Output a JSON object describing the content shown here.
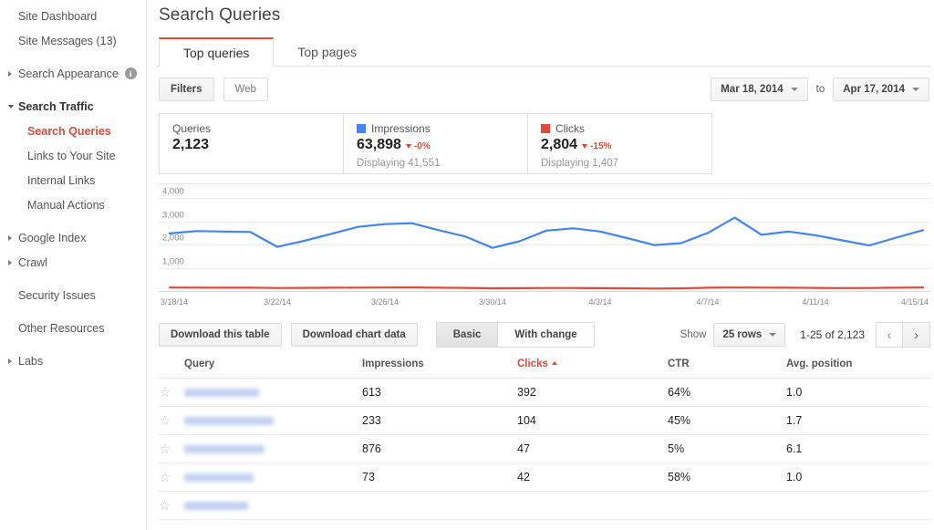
{
  "sidebar": {
    "items": [
      {
        "label": "Site Dashboard",
        "level": 0,
        "arrow": "none",
        "state": "normal",
        "info": false
      },
      {
        "label": "Site Messages (13)",
        "level": 0,
        "arrow": "none",
        "state": "normal",
        "info": false
      },
      {
        "label": "Search Appearance",
        "level": 0,
        "arrow": "right",
        "state": "normal",
        "info": true
      },
      {
        "label": "Search Traffic",
        "level": 0,
        "arrow": "down",
        "state": "bold",
        "info": false
      },
      {
        "label": "Search Queries",
        "level": 1,
        "arrow": "none",
        "state": "active",
        "info": false
      },
      {
        "label": "Links to Your Site",
        "level": 1,
        "arrow": "none",
        "state": "normal",
        "info": false
      },
      {
        "label": "Internal Links",
        "level": 1,
        "arrow": "none",
        "state": "normal",
        "info": false
      },
      {
        "label": "Manual Actions",
        "level": 1,
        "arrow": "none",
        "state": "normal",
        "info": false
      },
      {
        "label": "Google Index",
        "level": 0,
        "arrow": "right",
        "state": "normal",
        "info": false
      },
      {
        "label": "Crawl",
        "level": 0,
        "arrow": "right",
        "state": "normal",
        "info": false
      },
      {
        "label": "Security Issues",
        "level": 0,
        "arrow": "none",
        "state": "normal",
        "info": false
      },
      {
        "label": "Other Resources",
        "level": 0,
        "arrow": "none",
        "state": "normal",
        "info": false
      },
      {
        "label": "Labs",
        "level": 0,
        "arrow": "right",
        "state": "normal",
        "info": false
      }
    ],
    "info_glyph": "i"
  },
  "header": {
    "title": "Search Queries"
  },
  "tabs": [
    {
      "label": "Top queries",
      "active": true
    },
    {
      "label": "Top pages",
      "active": false
    }
  ],
  "toolbar": {
    "filters_label": "Filters",
    "web_label": "Web",
    "date_from": "Mar 18, 2014",
    "date_to_word": "to",
    "date_to": "Apr 17, 2014"
  },
  "summary": {
    "queries": {
      "label": "Queries",
      "value": "2,123"
    },
    "impressions": {
      "label": "Impressions",
      "value": "63,898",
      "delta": "-0%",
      "delta_direction": "down",
      "sub": "Displaying 41,551",
      "color": "#4285f4"
    },
    "clicks": {
      "label": "Clicks",
      "value": "2,804",
      "delta": "-15%",
      "delta_direction": "down",
      "sub": "Displaying 1,407",
      "color": "#dd4b39"
    }
  },
  "table_controls": {
    "download_table": "Download this table",
    "download_chart": "Download chart data",
    "basic": "Basic",
    "with_change": "With change",
    "show_label": "Show",
    "rows_value": "25 rows",
    "range_label": "1-25 of 2,123",
    "prev_glyph": "‹",
    "next_glyph": "›"
  },
  "table": {
    "columns": [
      {
        "key": "query",
        "label": "Query",
        "sorted": false
      },
      {
        "key": "impressions",
        "label": "Impressions",
        "sorted": false
      },
      {
        "key": "clicks",
        "label": "Clicks",
        "sorted": true,
        "sort_dir": "asc"
      },
      {
        "key": "ctr",
        "label": "CTR",
        "sorted": false
      },
      {
        "key": "position",
        "label": "Avg. position",
        "sorted": false
      }
    ],
    "star_glyph": "☆",
    "rows": [
      {
        "query": "",
        "query_redacted": true,
        "redact_width": 82,
        "impressions": "613",
        "clicks": "392",
        "ctr": "64%",
        "position": "1.0"
      },
      {
        "query": "",
        "query_redacted": true,
        "redact_width": 98,
        "impressions": "233",
        "clicks": "104",
        "ctr": "45%",
        "position": "1.7"
      },
      {
        "query": "",
        "query_redacted": true,
        "redact_width": 88,
        "impressions": "876",
        "clicks": "47",
        "ctr": "5%",
        "position": "6.1"
      },
      {
        "query": "",
        "query_redacted": true,
        "redact_width": 76,
        "impressions": "73",
        "clicks": "42",
        "ctr": "58%",
        "position": "1.0"
      },
      {
        "query": "",
        "query_redacted": true,
        "redact_width": 70,
        "impressions": "",
        "clicks": "",
        "ctr": "",
        "position": ""
      }
    ]
  },
  "chart_data": {
    "type": "line",
    "title": "",
    "xlabel": "",
    "ylabel": "",
    "ylim": [
      0,
      4400
    ],
    "yticks": [
      1000,
      2000,
      3000,
      4000
    ],
    "ytick_labels": [
      "1,000",
      "2,000",
      "3,000",
      "4,000"
    ],
    "grid": true,
    "legend_position": "above-chart",
    "x": [
      "3/18/14",
      "3/19/14",
      "3/20/14",
      "3/21/14",
      "3/22/14",
      "3/23/14",
      "3/24/14",
      "3/25/14",
      "3/26/14",
      "3/27/14",
      "3/28/14",
      "3/29/14",
      "3/30/14",
      "3/31/14",
      "4/1/14",
      "4/2/14",
      "4/3/14",
      "4/4/14",
      "4/5/14",
      "4/6/14",
      "4/7/14",
      "4/8/14",
      "4/9/14",
      "4/10/14",
      "4/11/14",
      "4/12/14",
      "4/13/14",
      "4/14/14",
      "4/15/14"
    ],
    "xtick_labels": [
      "3/18/14",
      "3/22/14",
      "3/26/14",
      "3/30/14",
      "4/3/14",
      "4/7/14",
      "4/11/14",
      "4/15/14"
    ],
    "xtick_indices": [
      0,
      4,
      8,
      12,
      16,
      20,
      24,
      28
    ],
    "series": [
      {
        "name": "Impressions",
        "color": "#4285f4",
        "values": [
          2480,
          2580,
          2560,
          2540,
          1900,
          2160,
          2460,
          2760,
          2880,
          2920,
          2620,
          2340,
          1860,
          2140,
          2600,
          2700,
          2560,
          2280,
          1980,
          2060,
          2500,
          3160,
          2420,
          2560,
          2400,
          2180,
          1960,
          2300,
          2620
        ]
      },
      {
        "name": "Clicks",
        "color": "#dd4b39",
        "values": [
          150,
          145,
          140,
          142,
          130,
          135,
          140,
          145,
          150,
          152,
          140,
          132,
          118,
          120,
          128,
          130,
          122,
          118,
          108,
          112,
          140,
          150,
          145,
          142,
          132,
          125,
          130,
          140,
          150
        ]
      }
    ]
  }
}
